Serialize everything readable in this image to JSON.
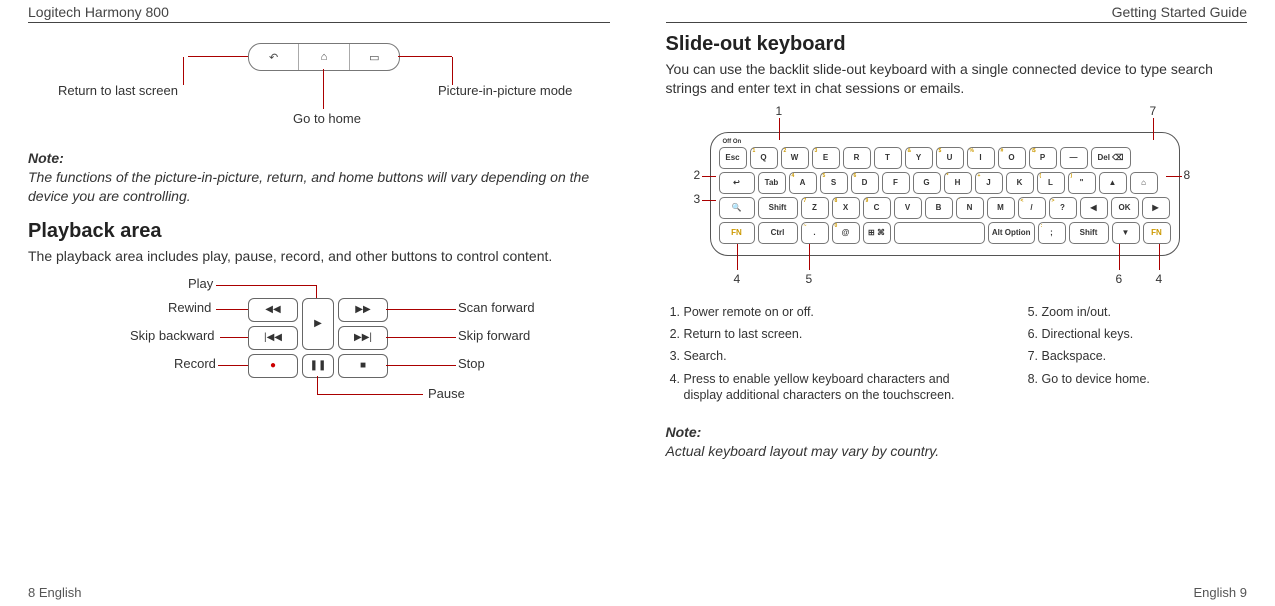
{
  "header": {
    "left": "Logitech Harmony 800",
    "right": "Getting Started Guide"
  },
  "footer": {
    "left": "8   English",
    "right": "English   9"
  },
  "left_page": {
    "nav": {
      "return_label": "Return to last screen",
      "home_label": "Go to home",
      "pip_label": "Picture-in-picture mode"
    },
    "note": {
      "title": "Note:",
      "body": "The functions of the picture-in-picture, return, and home buttons will vary depending on the device you are controlling."
    },
    "playback": {
      "title": "Playback area",
      "body": "The playback area includes play, pause, record, and other buttons to control content.",
      "labels": {
        "play": "Play",
        "rewind": "Rewind",
        "skip_back": "Skip backward",
        "record": "Record",
        "scan_fwd": "Scan forward",
        "skip_fwd": "Skip forward",
        "stop": "Stop",
        "pause": "Pause"
      }
    }
  },
  "right_page": {
    "title": "Slide-out keyboard",
    "intro": "You can use the backlit slide-out keyboard with a single connected device to type search strings and enter text in chat sessions or emails.",
    "keyboard": {
      "onoff": "Off   On",
      "row1": [
        "Esc",
        "Q",
        "W",
        "E",
        "R",
        "T",
        "Y",
        "U",
        "I",
        "O",
        "P",
        "—",
        "Del ⌫"
      ],
      "row1_sup": [
        "",
        "1",
        "2",
        "3",
        "",
        "",
        "&",
        "$",
        "%",
        "#",
        "\\$",
        "",
        ""
      ],
      "row2_left": "↩",
      "row2": [
        "Tab",
        "A",
        "S",
        "D",
        "F",
        "G",
        "H",
        "J",
        "K",
        "L",
        "\"",
        "▲",
        "⌂"
      ],
      "row2_sup": [
        "",
        "4",
        "5",
        "6",
        "",
        "",
        "*",
        "+",
        "",
        "(",
        ")",
        "",
        ""
      ],
      "row3_left": "🔍",
      "row3": [
        "Shift",
        "Z",
        "X",
        "C",
        "V",
        "B",
        "N",
        "M",
        "/",
        "?",
        "◀",
        "OK",
        "▶"
      ],
      "row3_sup": [
        "",
        "7",
        "8",
        "9",
        "",
        "",
        "`",
        "",
        "<",
        ">",
        "",
        "",
        ""
      ],
      "row4_left": "FN",
      "row4": [
        "Ctrl",
        ".",
        "@",
        "⊞ ⌘",
        "",
        "Alt Option",
        ";",
        "Shift",
        "▼",
        "FN"
      ],
      "row4_sup": [
        "",
        "~",
        "0",
        "",
        "",
        "",
        ":",
        "",
        "",
        ""
      ]
    },
    "callout_nums": {
      "n1": "1",
      "n2": "2",
      "n3": "3",
      "n4": "4",
      "n5": "5",
      "n6": "6",
      "n7": "7",
      "n8": "8"
    },
    "legend_left": [
      "Power remote on or off.",
      "Return to last screen.",
      "Search.",
      "Press to enable yellow keyboard characters and display additional characters on the touchscreen."
    ],
    "legend_right": [
      "Zoom in/out.",
      "Directional keys.",
      "Backspace.",
      "Go to device home."
    ],
    "note": {
      "title": "Note:",
      "body": "Actual keyboard layout may vary by country."
    }
  }
}
